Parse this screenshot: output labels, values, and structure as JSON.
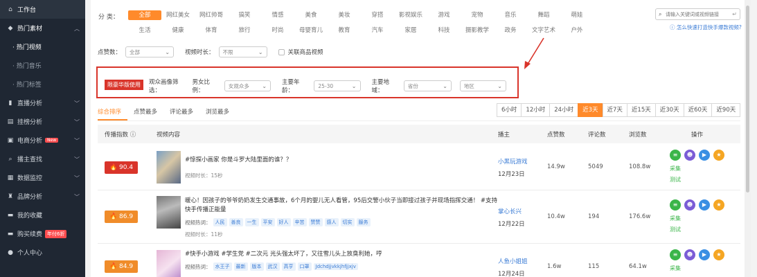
{
  "sidebar": {
    "items": [
      {
        "icon": "home-icon",
        "glyph": "⌂",
        "label": "工作台"
      },
      {
        "icon": "fire-icon",
        "glyph": "◆",
        "label": "热门素材"
      },
      {
        "label": "· 热门视频"
      },
      {
        "label": "· 热门音乐"
      },
      {
        "label": "· 热门标签"
      },
      {
        "icon": "live-icon",
        "glyph": "▮",
        "label": "直播分析"
      },
      {
        "icon": "chart-icon",
        "glyph": "▤",
        "label": "挂榜分析"
      },
      {
        "icon": "shop-icon",
        "glyph": "▣",
        "label": "电商分析",
        "badge": "New"
      },
      {
        "icon": "search-icon",
        "glyph": "⌕",
        "label": "播主查找"
      },
      {
        "icon": "monitor-icon",
        "glyph": "▦",
        "label": "数据监控"
      },
      {
        "icon": "brand-icon",
        "glyph": "♜",
        "label": "品牌分析"
      },
      {
        "icon": "collect-icon",
        "glyph": "▬",
        "label": "我的收藏"
      },
      {
        "icon": "cart-icon",
        "glyph": "▬",
        "label": "购买续费",
        "badge": "年付6折"
      },
      {
        "icon": "user-icon",
        "glyph": "●",
        "label": "个人中心"
      }
    ]
  },
  "categories": {
    "label": "分 类：",
    "row1": [
      "全部",
      "网红美女",
      "网红帅哥",
      "搞笑",
      "情感",
      "美食",
      "美妆",
      "穿搭",
      "影视娱乐",
      "游戏",
      "宠物",
      "音乐",
      "舞蹈",
      "萌娃"
    ],
    "row2": [
      "生活",
      "健康",
      "体育",
      "旅行",
      "时尚",
      "母婴育儿",
      "教育",
      "汽车",
      "家居",
      "科技",
      "摄影教学",
      "政务",
      "文字艺术",
      "户外"
    ]
  },
  "search": {
    "placeholder": "请输入关键词或视频链接",
    "help": "怎么快速打造快手爆款视频?"
  },
  "filters": {
    "likes_label": "点赞数：",
    "likes_value": "全部",
    "duration_label": "视频时长：",
    "duration_value": "不限",
    "product_label": "关联商品视频"
  },
  "audience": {
    "tag": "限豪华版使用",
    "label": "观众画像筛选：",
    "gender_label": "男女比例：",
    "gender_value": "女观众多",
    "age_label": "主要年龄：",
    "age_value": "25-30",
    "region_label": "主要地域：",
    "region_value": "省份",
    "city_value": "地区"
  },
  "sort_tabs": [
    "综合排序",
    "点赞最多",
    "评论最多",
    "浏览最多"
  ],
  "time_tabs": [
    "6小时",
    "12小时",
    "24小时",
    "近3天",
    "近7天",
    "近15天",
    "近30天",
    "近60天",
    "近90天"
  ],
  "table": {
    "headers": {
      "index": "传播指数",
      "info": "ⓘ",
      "content": "视频内容",
      "anchor": "播主",
      "likes": "点赞数",
      "comments": "评论数",
      "views": "浏览数",
      "ops": "操作"
    },
    "rows": [
      {
        "score": "🔥 90.4",
        "color": "#d9342a",
        "title": "#惊探小画家 你是斗罗大陆里面的谁？？",
        "sub": "视频时长：15秒",
        "tags_label": "",
        "tags": [],
        "anchor": "小黑玩游戏",
        "date": "12月23日",
        "likes": "14.9w",
        "comments": "5049",
        "views": "108.8w"
      },
      {
        "score": "🔥 86.9",
        "color": "#f08c2a",
        "title": "暖心！因孩子的爷爷奶奶发生交通事故，6个月的婴儿无人看管，95后交警小伙子当即接过孩子并现场指挥交通！ #支持快手传播正能量",
        "sub": "",
        "tags_label": "视频热词：",
        "tags": [
          "人民",
          "善良",
          "一生",
          "平安",
          "好人",
          "辛苦",
          "赞赞",
          "感人",
          "切实",
          "服务"
        ],
        "anchor": "掌心长兴",
        "date": "12月22日",
        "likes": "10.4w",
        "comments": "194",
        "views": "176.6w"
      },
      {
        "score": "🔥 84.9",
        "color": "#f08c2a",
        "title": "#快手小游戏 #学生党 #二次元 光头强太坏了，又往雪儿头上放臭利她，哼",
        "sub": "",
        "tags_label": "视频热词：",
        "tags": [
          "水王子",
          "最新",
          "版本",
          "武汉",
          "高亨",
          "口罩",
          "Jdchdjjvkkjhfjjxjv"
        ],
        "anchor": "人鱼小姐姐",
        "date": "12月24日",
        "likes": "1.6w",
        "comments": "115",
        "views": "64.1w"
      }
    ],
    "row2_sub": "视频时长：11秒"
  },
  "ops": {
    "collect": "采集",
    "test": "测试"
  }
}
